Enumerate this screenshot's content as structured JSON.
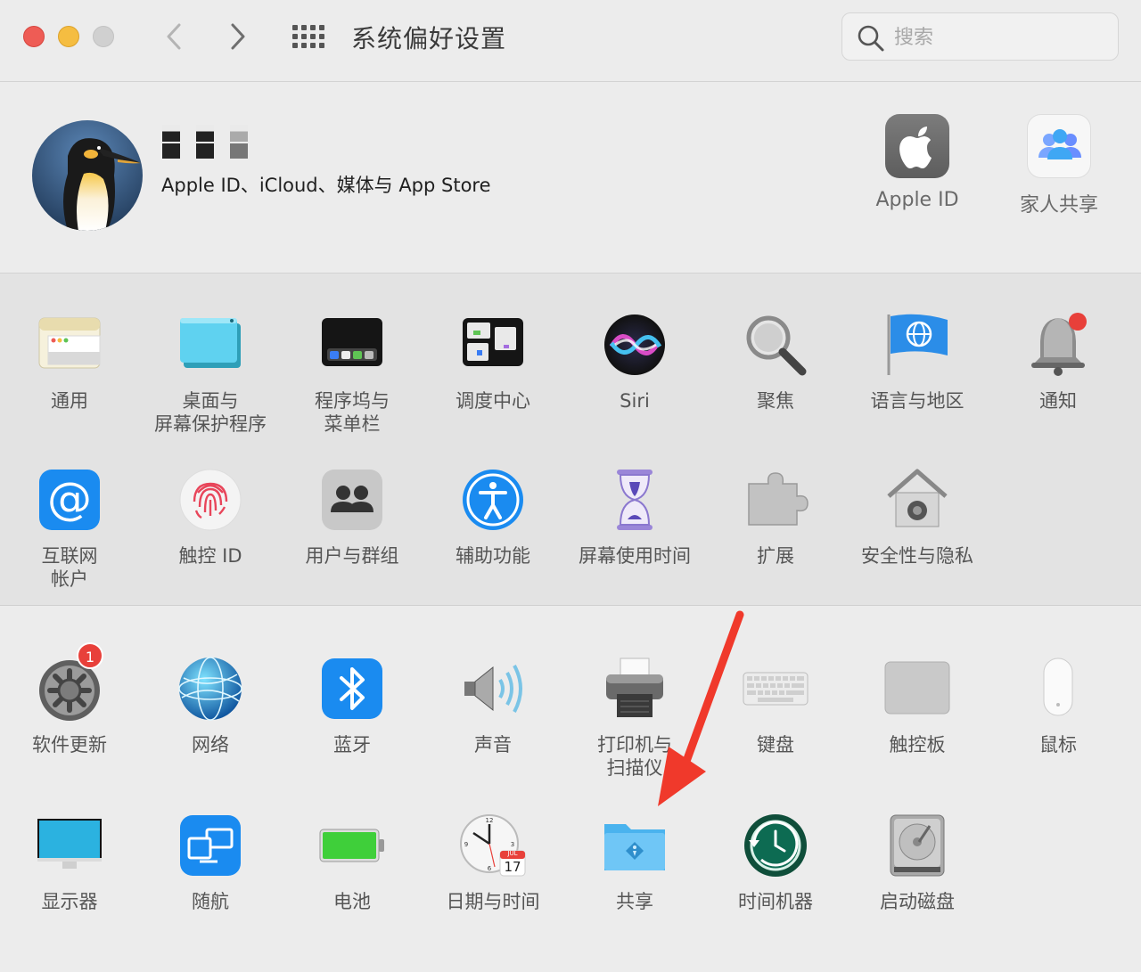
{
  "window": {
    "title": "系统偏好设置",
    "search_placeholder": "搜索"
  },
  "account": {
    "username_masked": "■ ■ ■",
    "subtitle": "Apple ID、iCloud、媒体与 App Store",
    "tiles": [
      {
        "label": "Apple ID",
        "icon": "apple-logo-icon"
      },
      {
        "label": "家人共享",
        "icon": "family-sharing-icon"
      }
    ]
  },
  "section1": {
    "items": [
      {
        "label": "通用",
        "icon": "general-icon"
      },
      {
        "label": "桌面与\n屏幕保护程序",
        "icon": "desktop-screensaver-icon"
      },
      {
        "label": "程序坞与\n菜单栏",
        "icon": "dock-menubar-icon"
      },
      {
        "label": "调度中心",
        "icon": "mission-control-icon"
      },
      {
        "label": "Siri",
        "icon": "siri-icon"
      },
      {
        "label": "聚焦",
        "icon": "spotlight-icon"
      },
      {
        "label": "语言与地区",
        "icon": "language-region-icon"
      },
      {
        "label": "通知",
        "icon": "notifications-icon"
      },
      {
        "label": "互联网\n帐户",
        "icon": "internet-accounts-icon"
      },
      {
        "label": "触控 ID",
        "icon": "touch-id-icon"
      },
      {
        "label": "用户与群组",
        "icon": "users-groups-icon"
      },
      {
        "label": "辅助功能",
        "icon": "accessibility-icon"
      },
      {
        "label": "屏幕使用时间",
        "icon": "screen-time-icon"
      },
      {
        "label": "扩展",
        "icon": "extensions-icon"
      },
      {
        "label": "安全性与隐私",
        "icon": "security-privacy-icon"
      }
    ]
  },
  "section2": {
    "items": [
      {
        "label": "软件更新",
        "icon": "software-update-icon",
        "badge": "1"
      },
      {
        "label": "网络",
        "icon": "network-icon"
      },
      {
        "label": "蓝牙",
        "icon": "bluetooth-icon"
      },
      {
        "label": "声音",
        "icon": "sound-icon"
      },
      {
        "label": "打印机与\n扫描仪",
        "icon": "printers-scanners-icon"
      },
      {
        "label": "键盘",
        "icon": "keyboard-icon"
      },
      {
        "label": "触控板",
        "icon": "trackpad-icon"
      },
      {
        "label": "鼠标",
        "icon": "mouse-icon"
      },
      {
        "label": "显示器",
        "icon": "displays-icon"
      },
      {
        "label": "随航",
        "icon": "sidecar-icon"
      },
      {
        "label": "电池",
        "icon": "battery-icon"
      },
      {
        "label": "日期与时间",
        "icon": "date-time-icon",
        "calendar_month": "JUL",
        "calendar_day": "17"
      },
      {
        "label": "共享",
        "icon": "sharing-icon"
      },
      {
        "label": "时间机器",
        "icon": "time-machine-icon"
      },
      {
        "label": "启动磁盘",
        "icon": "startup-disk-icon"
      }
    ]
  },
  "colors": {
    "accent_arrow": "#f0392b",
    "badge": "#e8403a"
  }
}
